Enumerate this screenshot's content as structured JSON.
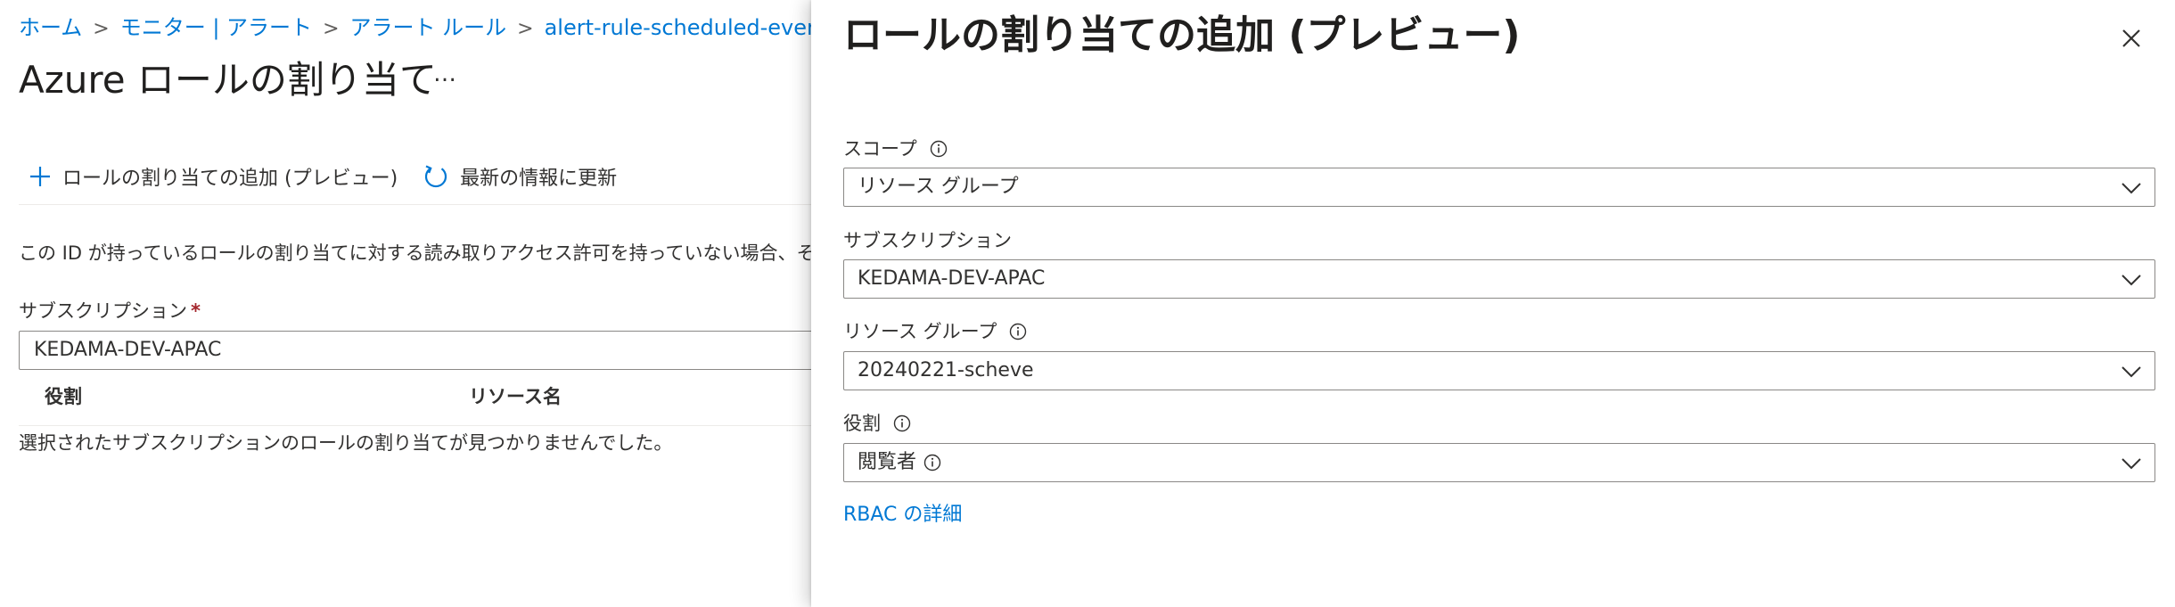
{
  "breadcrumb": [
    {
      "label": "ホーム"
    },
    {
      "label": "モニター | アラート"
    },
    {
      "label": "アラート ルール"
    },
    {
      "label": "alert-rule-scheduled-event | ID"
    }
  ],
  "page": {
    "title": "Azure ロールの割り当て",
    "more": "…"
  },
  "toolbar": {
    "add_label": "ロールの割り当ての追加 (プレビュー)",
    "refresh_label": "最新の情報に更新"
  },
  "main": {
    "info_text": "この ID が持っているロールの割り当てに対する読み取りアクセス許可を持っていない場合、そのロー",
    "subscription_label": "サブスクリプション",
    "subscription_required": "*",
    "subscription_value": "KEDAMA-DEV-APAC",
    "table_headers": [
      "役割",
      "リソース名"
    ],
    "empty_message": "選択されたサブスクリプションのロールの割り当てが見つかりませんでした。"
  },
  "panel": {
    "title": "ロールの割り当ての追加 (プレビュー)",
    "fields": [
      {
        "label": "スコープ",
        "value": "リソース グループ"
      },
      {
        "label": "サブスクリプション",
        "value": "KEDAMA-DEV-APAC"
      },
      {
        "label": "リソース グループ",
        "value": "20240221-scheve"
      },
      {
        "label": "役割",
        "value": "閲覧者"
      }
    ],
    "link": "RBAC の詳細"
  },
  "colors": {
    "accent": "#0078d4",
    "required": "#a4262c",
    "border": "#8a8886"
  },
  "icons": {
    "add": "plus-icon",
    "refresh": "refresh-icon",
    "close": "close-icon",
    "info": "info-icon",
    "dropdown": "chevron-down-icon"
  }
}
